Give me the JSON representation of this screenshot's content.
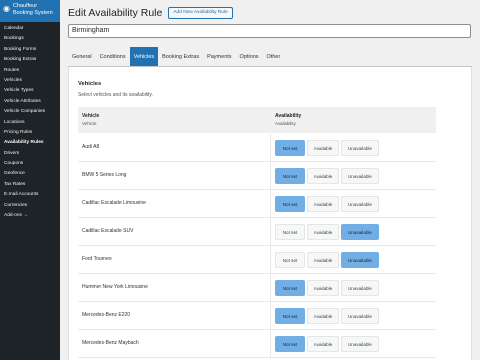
{
  "sidebar": {
    "plugin_icon": "car-icon",
    "plugin_title": "Chauffeur Booking System",
    "items": [
      {
        "label": "Calendar"
      },
      {
        "label": "Bookings"
      },
      {
        "label": "Booking Forms"
      },
      {
        "label": "Booking Extras"
      },
      {
        "label": "Routes"
      },
      {
        "label": "Vehicles"
      },
      {
        "label": "Vehicle Types"
      },
      {
        "label": "Vehicle Attributes"
      },
      {
        "label": "Vehicle Companies"
      },
      {
        "label": "Locations"
      },
      {
        "label": "Pricing Rules"
      },
      {
        "label": "Availability Rules"
      },
      {
        "label": "Drivers"
      },
      {
        "label": "Coupons"
      },
      {
        "label": "Geofence"
      },
      {
        "label": "Tax Rates"
      },
      {
        "label": "E-mail Accounts"
      },
      {
        "label": "Currencies"
      },
      {
        "label": "Add-ons →"
      }
    ],
    "current_item": "Availability Rules"
  },
  "header": {
    "title": "Edit Availability Rule",
    "add_new_label": "Add New Availability Rule"
  },
  "title_field": {
    "value": "Birmingham"
  },
  "tabs": [
    {
      "label": "General"
    },
    {
      "label": "Conditions"
    },
    {
      "label": "Vehicles"
    },
    {
      "label": "Booking Extras"
    },
    {
      "label": "Payments"
    },
    {
      "label": "Options"
    },
    {
      "label": "Other"
    }
  ],
  "active_tab": "Vehicles",
  "section": {
    "title": "Vehicles",
    "description": "Select vehicles and its availability."
  },
  "table": {
    "col_vehicle": "Vehicle",
    "col_vehicle_sub": "Vehicle.",
    "col_availability": "Availability",
    "col_availability_sub": "Availability.",
    "options": [
      "Not set",
      "Available",
      "Unavailable"
    ],
    "rows": [
      {
        "vehicle": "Audi A8",
        "selected": "Not set"
      },
      {
        "vehicle": "BMW 5 Series Long",
        "selected": "Not set"
      },
      {
        "vehicle": "Cadillac Escalade Limousine",
        "selected": "Not set"
      },
      {
        "vehicle": "Cadillac Escalade SUV",
        "selected": "Unavailable"
      },
      {
        "vehicle": "Ford Tourneo",
        "selected": "Unavailable"
      },
      {
        "vehicle": "Hummer New York Limousine",
        "selected": "Not set"
      },
      {
        "vehicle": "Mercedes-Benz E220",
        "selected": "Not set"
      },
      {
        "vehicle": "Mercedes-Benz Maybach",
        "selected": "Not set"
      }
    ]
  },
  "colors": {
    "sidebar_bg": "#1d2327",
    "accent": "#2271b1",
    "selected_button": "#72aee6"
  }
}
